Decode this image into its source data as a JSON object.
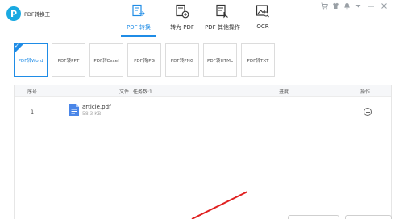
{
  "app": {
    "title": "PDF转换王",
    "logo_letter": "P",
    "accent_color": "#1f8ce6",
    "logo_color": "#19a9e1"
  },
  "nav_tabs": [
    {
      "label": "PDF 转换",
      "icon": "pdf-convert-icon",
      "active": true
    },
    {
      "label": "转为 PDF",
      "icon": "to-pdf-icon",
      "active": false
    },
    {
      "label": "PDF 其他操作",
      "icon": "pdf-tools-icon",
      "active": false
    },
    {
      "label": "OCR",
      "icon": "ocr-icon",
      "active": false
    }
  ],
  "window_controls": [
    "cart-icon",
    "skin-icon",
    "bell-icon",
    "menu-icon",
    "minimize-icon",
    "close-icon"
  ],
  "formats": [
    {
      "label": "PDF转Word",
      "active": true
    },
    {
      "label": "PDF转PPT",
      "active": false
    },
    {
      "label": "PDF转Excel",
      "active": false
    },
    {
      "label": "PDF转JPG",
      "active": false
    },
    {
      "label": "PDF转PNG",
      "active": false
    },
    {
      "label": "PDF转HTML",
      "active": false
    },
    {
      "label": "PDF转TXT",
      "active": false
    }
  ],
  "table": {
    "headers": {
      "index": "序号",
      "file": "文件",
      "task_count": "任务数:1",
      "progress": "进度",
      "action": "操作"
    },
    "rows": [
      {
        "index": "1",
        "name": "article.pdf",
        "size": "58.3 KB"
      }
    ]
  },
  "annotation": {
    "arrow_color": "#e02020"
  }
}
